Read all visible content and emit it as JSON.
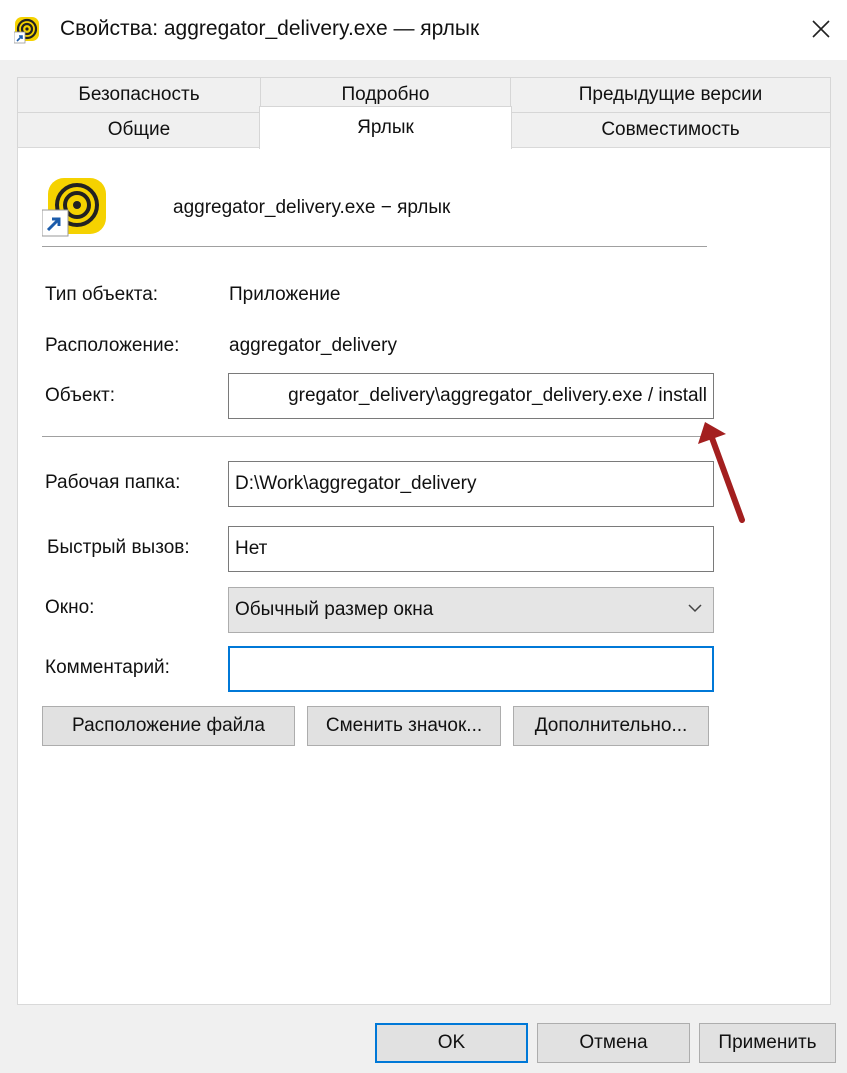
{
  "window": {
    "title": "Свойства: aggregator_delivery.exe — ярлык",
    "close_glyph": "✕"
  },
  "tabs": {
    "row1": [
      {
        "label": "Безопасность"
      },
      {
        "label": "Подробно"
      },
      {
        "label": "Предыдущие версии"
      }
    ],
    "row2": [
      {
        "label": "Общие"
      },
      {
        "label": "Ярлык",
        "active": true
      },
      {
        "label": "Совместимость"
      }
    ]
  },
  "shortcut": {
    "name": "aggregator_delivery.exe − ярлык",
    "icon": "app-spiral-icon",
    "overlay_icon": "shortcut-arrow-icon",
    "accent_color": "#f5d200"
  },
  "fields": {
    "type_label": "Тип объекта:",
    "type_value": "Приложение",
    "location_label": "Расположение:",
    "location_value": "aggregator_delivery",
    "target_label": "Объект:",
    "target_value": "gregator_delivery\\aggregator_delivery.exe / install",
    "workdir_label": "Рабочая папка:",
    "workdir_value": "D:\\Work\\aggregator_delivery",
    "hotkey_label": "Быстрый вызов:",
    "hotkey_value": "Нет",
    "window_label": "Окно:",
    "window_value": "Обычный размер окна",
    "comment_label": "Комментарий:",
    "comment_value": ""
  },
  "actions": {
    "open_location": "Расположение файла",
    "change_icon": "Сменить значок...",
    "advanced": "Дополнительно..."
  },
  "footer": {
    "ok": "OK",
    "cancel": "Отмена",
    "apply": "Применить"
  },
  "annotation": {
    "arrow_color": "#a31f1f"
  }
}
